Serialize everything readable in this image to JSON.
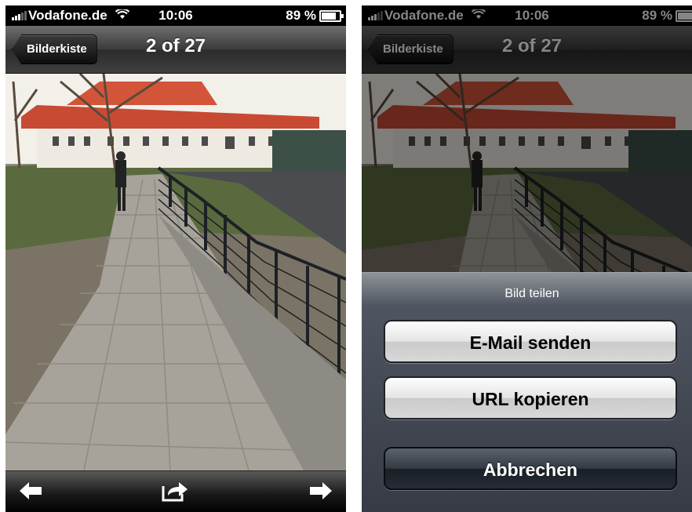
{
  "status_bar": {
    "carrier": "Vodafone.de",
    "time": "10:06",
    "battery": "89 %"
  },
  "navbar": {
    "back_label": "Bilderkiste",
    "title": "2 of 27"
  },
  "toolbar": {
    "icons": [
      "arrow-left-icon",
      "share-icon",
      "arrow-right-icon"
    ]
  },
  "share_sheet": {
    "title": "Bild teilen",
    "email_button": "E-Mail senden",
    "copy_url_button": "URL kopieren",
    "cancel_button": "Abbrechen"
  },
  "colors": {
    "navbar": "#3b3b3b",
    "sheet": "#363b45",
    "roof": "#d2553a",
    "sky": "#f4f1ec"
  }
}
